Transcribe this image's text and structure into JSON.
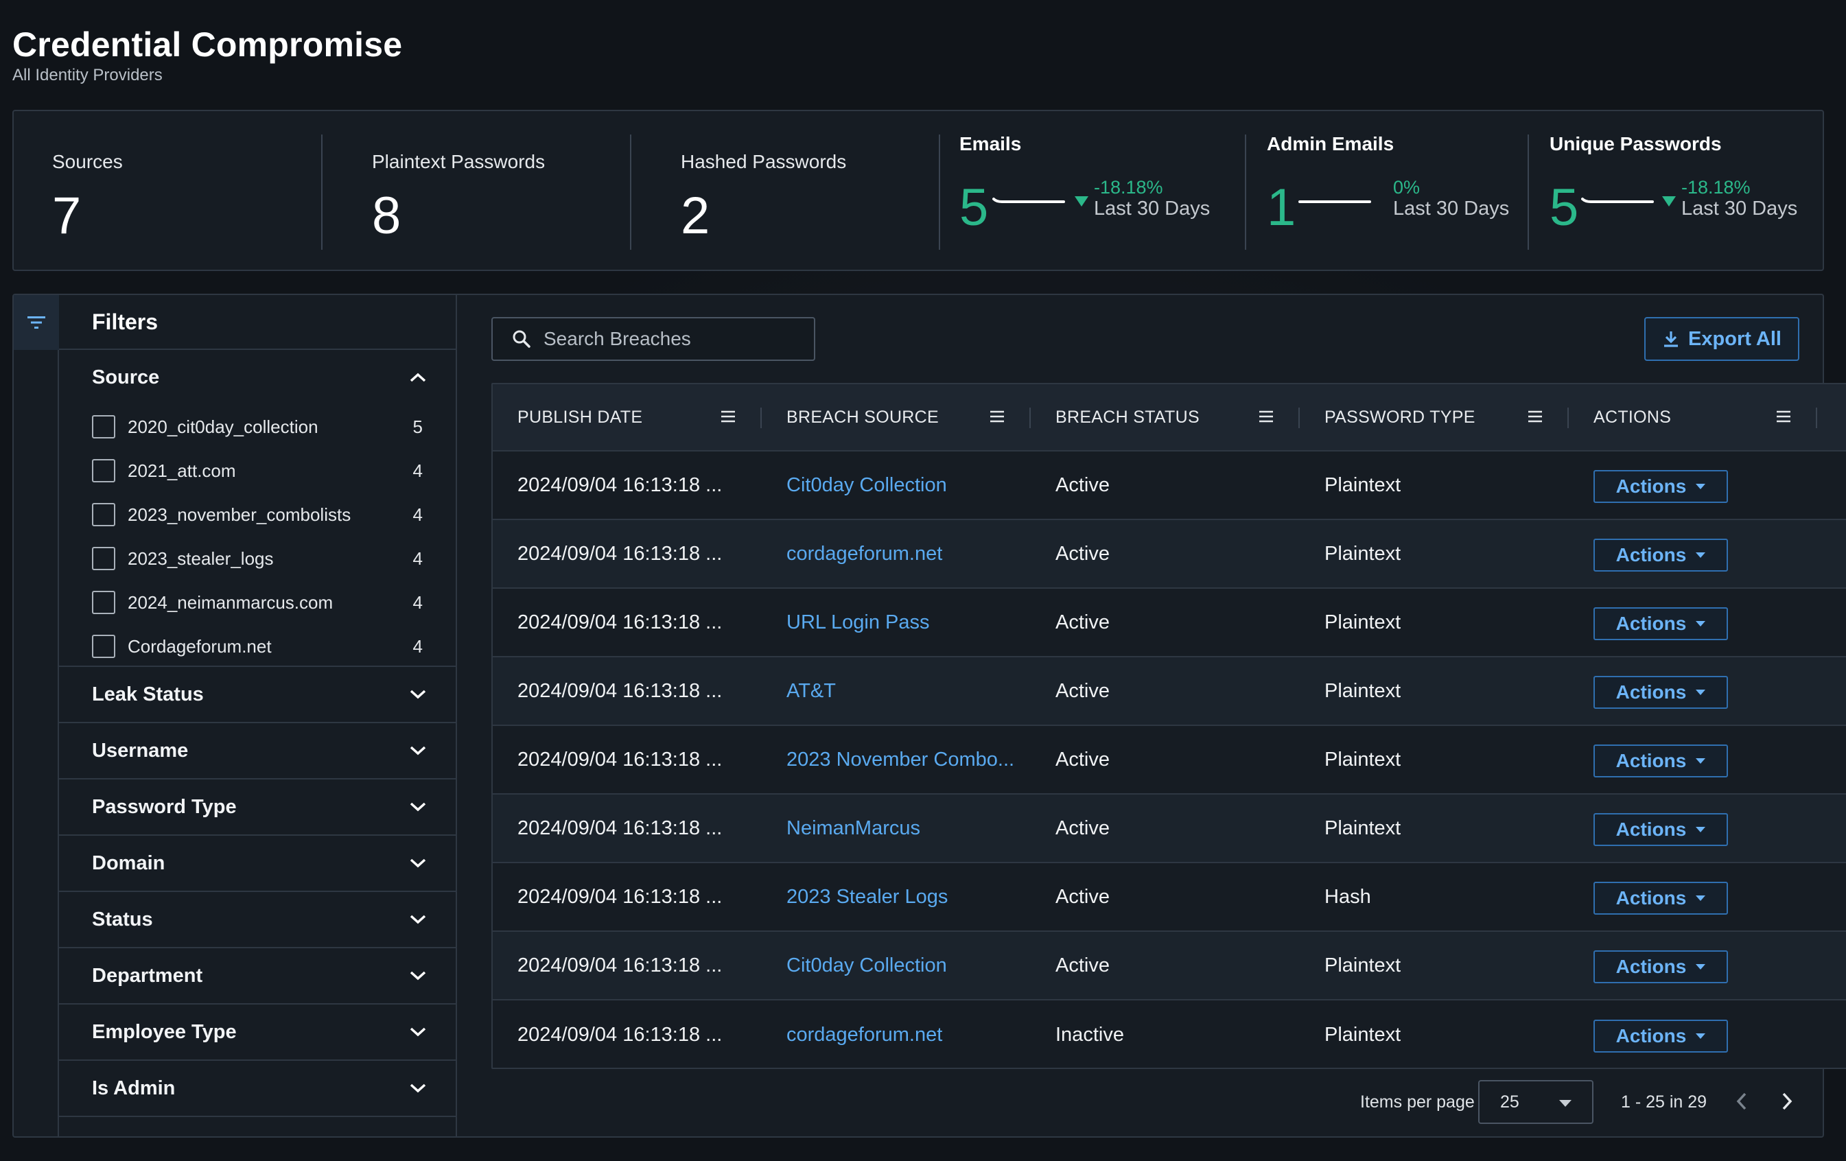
{
  "header": {
    "title": "Credential Compromise",
    "subtitle": "All Identity Providers"
  },
  "stats": {
    "sources": {
      "label": "Sources",
      "value": "7"
    },
    "plaintext": {
      "label": "Plaintext Passwords",
      "value": "8"
    },
    "hashed": {
      "label": "Hashed Passwords",
      "value": "2"
    },
    "emails": {
      "label": "Emails",
      "value": "5",
      "change": "-18.18%",
      "period": "Last 30 Days",
      "trend": "down"
    },
    "admin_emails": {
      "label": "Admin Emails",
      "value": "1",
      "change": "0%",
      "period": "Last 30 Days",
      "trend": "flat"
    },
    "unique_passwords": {
      "label": "Unique Passwords",
      "value": "5",
      "change": "-18.18%",
      "period": "Last 30 Days",
      "trend": "down"
    }
  },
  "filters": {
    "title": "Filters",
    "source": {
      "label": "Source",
      "items": [
        {
          "name": "2020_cit0day_collection",
          "count": "5"
        },
        {
          "name": "2021_att.com",
          "count": "4"
        },
        {
          "name": "2023_november_combolists",
          "count": "4"
        },
        {
          "name": "2023_stealer_logs",
          "count": "4"
        },
        {
          "name": "2024_neimanmarcus.com",
          "count": "4"
        },
        {
          "name": "Cordageforum.net",
          "count": "4"
        }
      ]
    },
    "sections": [
      "Leak Status",
      "Username",
      "Password Type",
      "Domain",
      "Status",
      "Department",
      "Employee Type",
      "Is Admin"
    ]
  },
  "search": {
    "placeholder": "Search Breaches"
  },
  "export_label": "Export All",
  "table": {
    "columns": [
      "PUBLISH DATE",
      "BREACH SOURCE",
      "BREACH STATUS",
      "PASSWORD TYPE",
      "ACTIONS"
    ],
    "action_label": "Actions",
    "rows": [
      {
        "date": "2024/09/04 16:13:18 ...",
        "source": "Cit0day Collection",
        "status": "Active",
        "type": "Plaintext"
      },
      {
        "date": "2024/09/04 16:13:18 ...",
        "source": "cordageforum.net",
        "status": "Active",
        "type": "Plaintext"
      },
      {
        "date": "2024/09/04 16:13:18 ...",
        "source": "URL Login Pass",
        "status": "Active",
        "type": "Plaintext"
      },
      {
        "date": "2024/09/04 16:13:18 ...",
        "source": "AT&T",
        "status": "Active",
        "type": "Plaintext"
      },
      {
        "date": "2024/09/04 16:13:18 ...",
        "source": "2023 November Combo...",
        "status": "Active",
        "type": "Plaintext"
      },
      {
        "date": "2024/09/04 16:13:18 ...",
        "source": "NeimanMarcus",
        "status": "Active",
        "type": "Plaintext"
      },
      {
        "date": "2024/09/04 16:13:18 ...",
        "source": "2023 Stealer Logs",
        "status": "Active",
        "type": "Hash"
      },
      {
        "date": "2024/09/04 16:13:18 ...",
        "source": "Cit0day Collection",
        "status": "Active",
        "type": "Plaintext"
      },
      {
        "date": "2024/09/04 16:13:18 ...",
        "source": "cordageforum.net",
        "status": "Inactive",
        "type": "Plaintext"
      }
    ]
  },
  "pagination": {
    "items_per_page_label": "Items per page",
    "items_per_page": "25",
    "range": "1 - 25 in 29"
  },
  "colors": {
    "accent": "#5aaaf0",
    "positive": "#2bb88a",
    "panel": "#161c23",
    "background": "#101419"
  }
}
